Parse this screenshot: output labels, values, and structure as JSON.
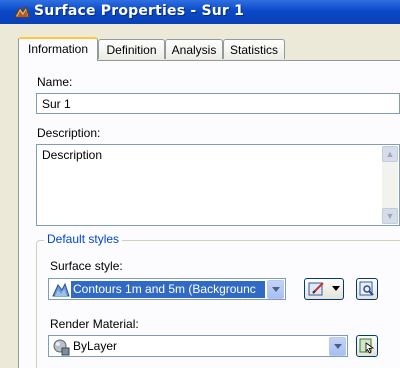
{
  "window": {
    "title": "Surface Properties - Sur 1",
    "app_icon": "surface-app-icon"
  },
  "tabs": [
    {
      "label": "Information",
      "active": true
    },
    {
      "label": "Definition",
      "active": false
    },
    {
      "label": "Analysis",
      "active": false
    },
    {
      "label": "Statistics",
      "active": false
    }
  ],
  "name": {
    "label": "Name:",
    "value": "Sur 1"
  },
  "description": {
    "label": "Description:",
    "value": "Description"
  },
  "default_styles": {
    "title": "Default styles",
    "surface_style": {
      "label": "Surface style:",
      "value": "Contours 1m and 5m (Backgrounc",
      "icon": "surface-style-icon"
    },
    "render_material": {
      "label": "Render Material:",
      "value": "ByLayer",
      "icon": "material-sphere-icon"
    }
  },
  "colors": {
    "title_bar": "#0a49c9",
    "group_title": "#0046d5",
    "selection": "#316ac5",
    "active_tab_accent": "#ffc83c"
  }
}
